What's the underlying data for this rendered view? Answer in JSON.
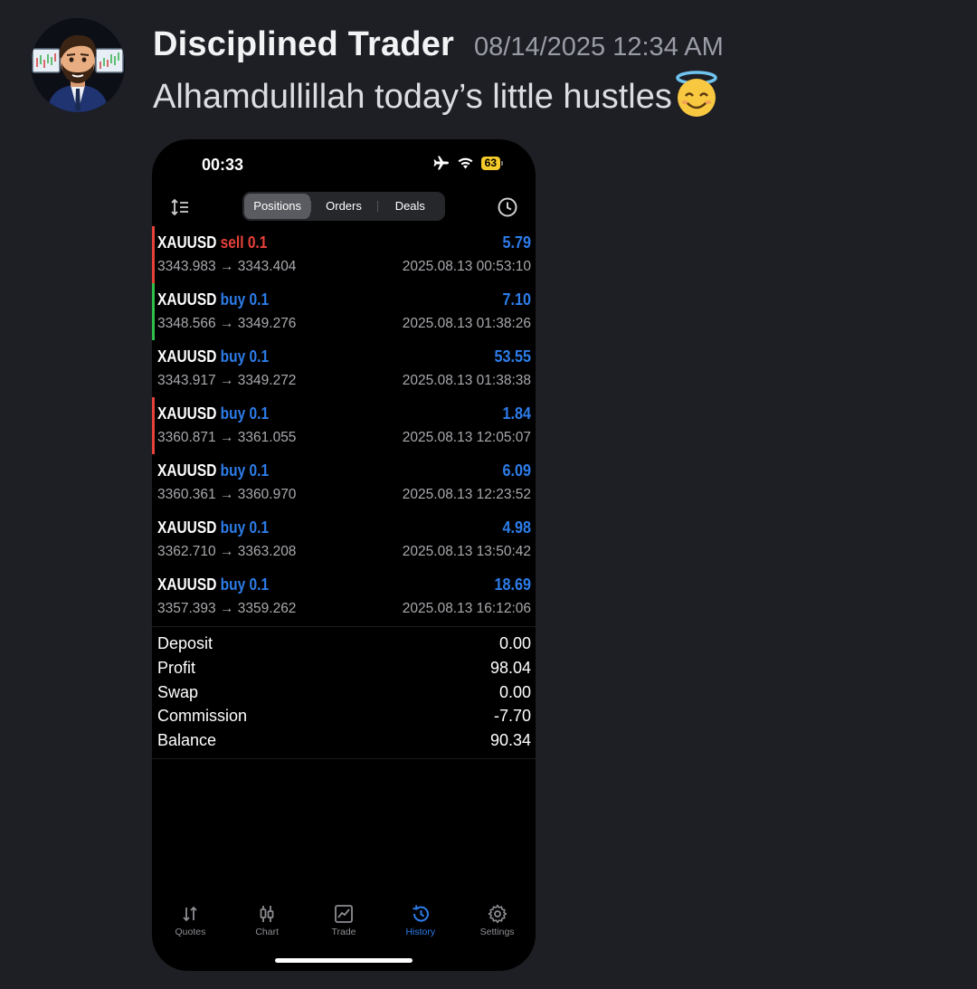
{
  "message": {
    "author": "Disciplined Trader",
    "timestamp": "08/14/2025 12:34 AM",
    "text": "Alhamdullillah today’s little hustles",
    "emoji": "smiling-face-with-halo"
  },
  "phone": {
    "status_bar": {
      "time": "00:33",
      "battery": "63"
    },
    "segments": [
      "Positions",
      "Orders",
      "Deals"
    ],
    "active_segment": "Positions",
    "deals": [
      {
        "symbol": "XAUUSD",
        "side": "sell",
        "volume": "0.1",
        "profit": "5.79",
        "open_price": "3343.983",
        "close_price": "3343.404",
        "arrow": "→",
        "time": "2025.08.13 00:53:10",
        "bar_color": "#e8413a"
      },
      {
        "symbol": "XAUUSD",
        "side": "buy",
        "volume": "0.1",
        "profit": "7.10",
        "open_price": "3348.566",
        "close_price": "3349.276",
        "arrow": "→",
        "time": "2025.08.13 01:38:26",
        "bar_color": "#2fbf4a"
      },
      {
        "symbol": "XAUUSD",
        "side": "buy",
        "volume": "0.1",
        "profit": "53.55",
        "open_price": "3343.917",
        "close_price": "3349.272",
        "arrow": "→",
        "time": "2025.08.13 01:38:38",
        "bar_color": ""
      },
      {
        "symbol": "XAUUSD",
        "side": "buy",
        "volume": "0.1",
        "profit": "1.84",
        "open_price": "3360.871",
        "close_price": "3361.055",
        "arrow": "→",
        "time": "2025.08.13 12:05:07",
        "bar_color": "#e8413a"
      },
      {
        "symbol": "XAUUSD",
        "side": "buy",
        "volume": "0.1",
        "profit": "6.09",
        "open_price": "3360.361",
        "close_price": "3360.970",
        "arrow": "→",
        "time": "2025.08.13 12:23:52",
        "bar_color": ""
      },
      {
        "symbol": "XAUUSD",
        "side": "buy",
        "volume": "0.1",
        "profit": "4.98",
        "open_price": "3362.710",
        "close_price": "3363.208",
        "arrow": "→",
        "time": "2025.08.13 13:50:42",
        "bar_color": ""
      },
      {
        "symbol": "XAUUSD",
        "side": "buy",
        "volume": "0.1",
        "profit": "18.69",
        "open_price": "3357.393",
        "close_price": "3359.262",
        "arrow": "→",
        "time": "2025.08.13 16:12:06",
        "bar_color": ""
      }
    ],
    "summary": [
      {
        "label": "Deposit",
        "value": "0.00"
      },
      {
        "label": "Profit",
        "value": "98.04"
      },
      {
        "label": "Swap",
        "value": "0.00"
      },
      {
        "label": "Commission",
        "value": "-7.70"
      },
      {
        "label": "Balance",
        "value": "90.34"
      }
    ],
    "tabs": [
      {
        "label": "Quotes",
        "icon": "quotes-icon"
      },
      {
        "label": "Chart",
        "icon": "chart-icon"
      },
      {
        "label": "Trade",
        "icon": "trade-icon"
      },
      {
        "label": "History",
        "icon": "history-icon"
      },
      {
        "label": "Settings",
        "icon": "settings-icon"
      }
    ],
    "active_tab": "History",
    "colors": {
      "sell": "#e8413a",
      "buy": "#2d7dea",
      "accent": "#2d7dea",
      "battery": "#f5cc2b"
    }
  }
}
